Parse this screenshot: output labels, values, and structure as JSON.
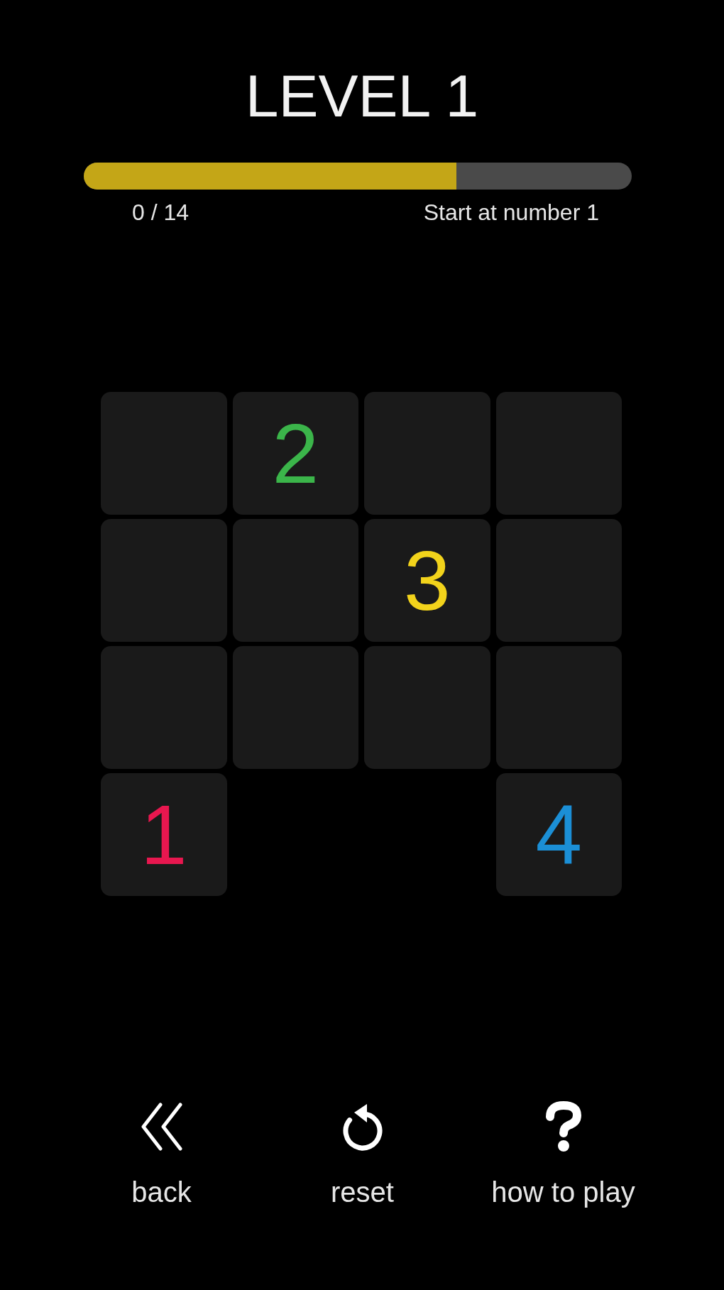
{
  "title": "LEVEL 1",
  "progress": {
    "level": 0.68,
    "count": "0 / 14",
    "hint": "Start at number 1"
  },
  "grid": {
    "rows": [
      {
        "cells": [
          {
            "kind": "blank"
          },
          {
            "kind": "number",
            "text": "2",
            "color": "#3bb54a"
          },
          {
            "kind": "blank"
          },
          {
            "kind": "blank"
          }
        ]
      },
      {
        "cells": [
          {
            "kind": "blank"
          },
          {
            "kind": "blank"
          },
          {
            "kind": "number",
            "text": "3",
            "color": "#f2d31b"
          },
          {
            "kind": "blank"
          }
        ]
      },
      {
        "cells": [
          {
            "kind": "blank"
          },
          {
            "kind": "blank"
          },
          {
            "kind": "blank"
          },
          {
            "kind": "blank"
          }
        ]
      },
      {
        "cells": [
          {
            "kind": "number",
            "text": "1",
            "color": "#e8174f"
          },
          {
            "kind": "gap"
          },
          {
            "kind": "gap"
          },
          {
            "kind": "number",
            "text": "4",
            "color": "#1b8fd6"
          }
        ]
      }
    ]
  },
  "toolbar": [
    {
      "kind": "back",
      "label": "back"
    },
    {
      "kind": "reset",
      "label": "reset"
    },
    {
      "kind": "help",
      "label": "how to play"
    }
  ]
}
